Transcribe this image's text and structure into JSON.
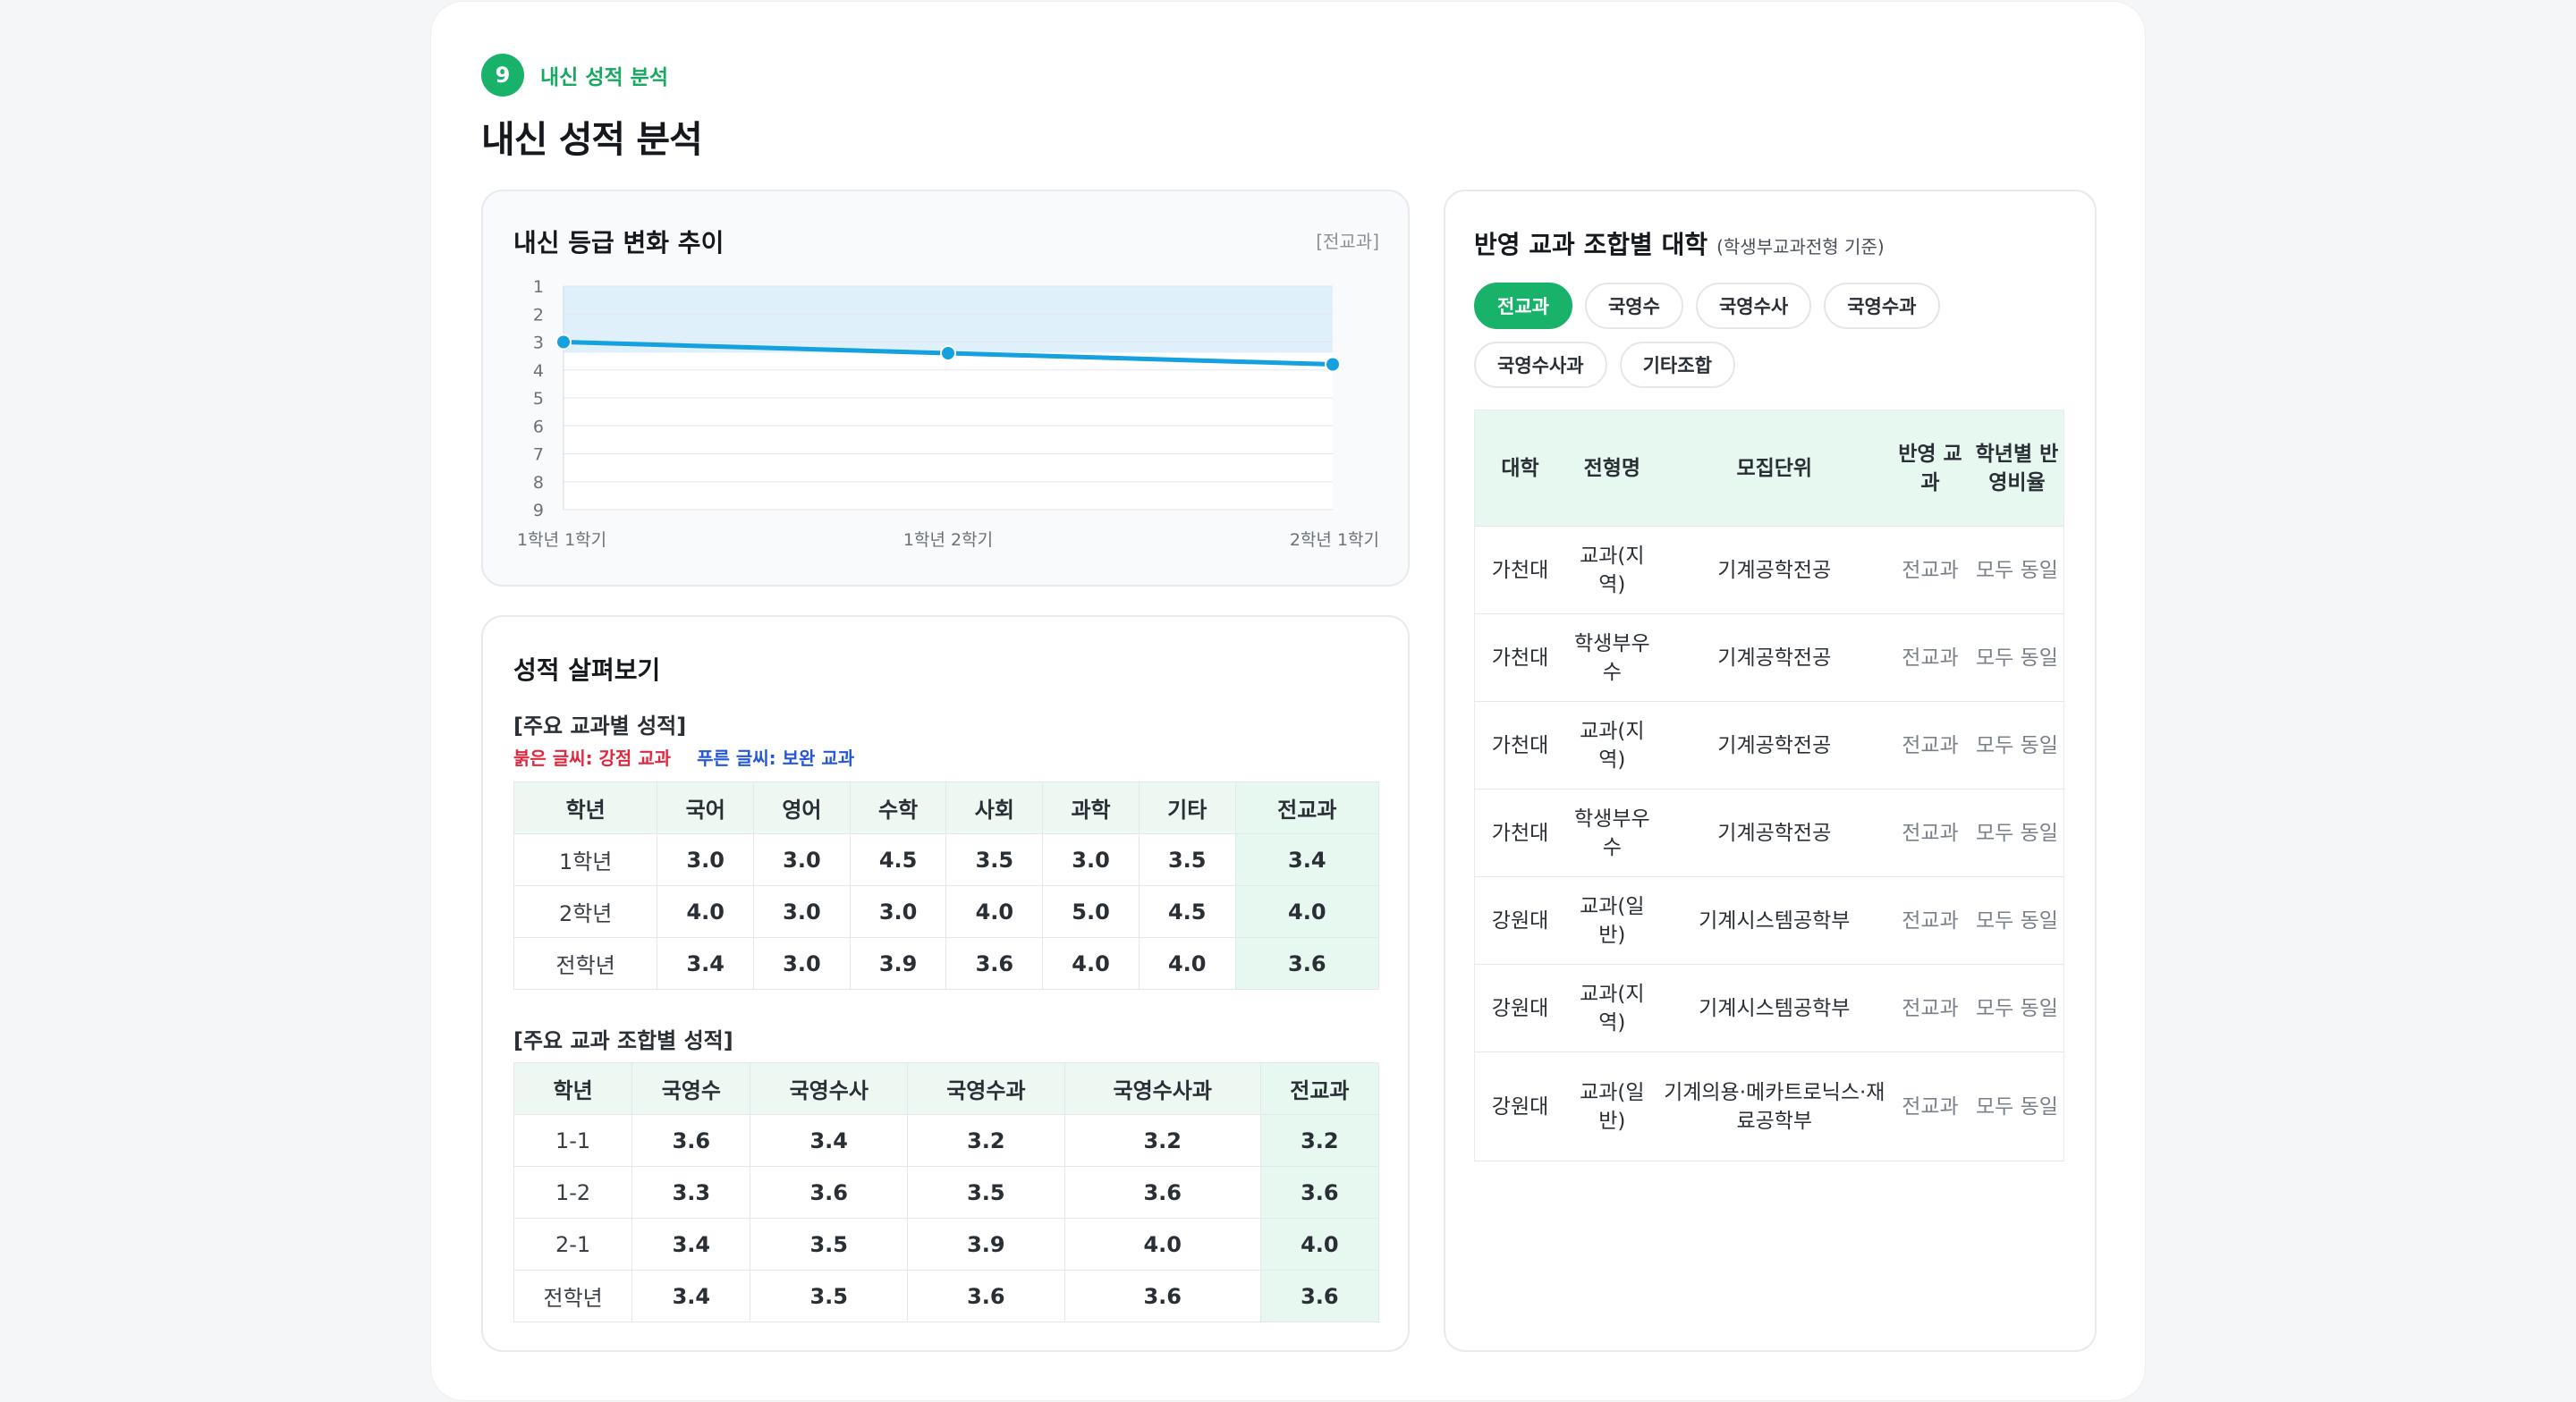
{
  "header": {
    "step_number": "9",
    "step_label": "내신 성적 분석",
    "title": "내신 성적 분석"
  },
  "trend": {
    "title": "내신 등급 변화 추이",
    "tag": "[전교과]"
  },
  "chart_data": {
    "type": "line",
    "x": [
      "1학년 1학기",
      "1학년 2학기",
      "2학년 1학기"
    ],
    "series": [
      {
        "values": [
          3.0,
          3.4,
          3.8
        ]
      }
    ],
    "y_ticks": [
      "1",
      "2",
      "3",
      "4",
      "5",
      "6",
      "7",
      "8",
      "9"
    ],
    "ylim": [
      1,
      9
    ],
    "y_inverted": true,
    "grid": true,
    "line_color": "#15a0e0",
    "fill_color": "#dff0fb"
  },
  "detail": {
    "title": "성적 살펴보기",
    "subject_title": "[주요 교과별 성적]",
    "legend_red": "붉은 글씨: 강점 교과",
    "legend_blue": "푸른 글씨: 보완 교과",
    "subject_table": {
      "headers": [
        "학년",
        "국어",
        "영어",
        "수학",
        "사회",
        "과학",
        "기타",
        "전교과"
      ],
      "rows": [
        [
          "1학년",
          "3.0",
          "3.0",
          "4.5",
          "3.5",
          "3.0",
          "3.5",
          "3.4"
        ],
        [
          "2학년",
          "4.0",
          "3.0",
          "3.0",
          "4.0",
          "5.0",
          "4.5",
          "4.0"
        ],
        [
          "전학년",
          "3.4",
          "3.0",
          "3.9",
          "3.6",
          "4.0",
          "4.0",
          "3.6"
        ]
      ]
    },
    "combo_title": "[주요 교과 조합별 성적]",
    "combo_table": {
      "headers": [
        "학년",
        "국영수",
        "국영수사",
        "국영수과",
        "국영수사과",
        "전교과"
      ],
      "rows": [
        [
          "1-1",
          "3.6",
          "3.4",
          "3.2",
          "3.2",
          "3.2"
        ],
        [
          "1-2",
          "3.3",
          "3.6",
          "3.5",
          "3.6",
          "3.6"
        ],
        [
          "2-1",
          "3.4",
          "3.5",
          "3.9",
          "4.0",
          "4.0"
        ],
        [
          "전학년",
          "3.4",
          "3.5",
          "3.6",
          "3.6",
          "3.6"
        ]
      ]
    }
  },
  "univ": {
    "title": "반영 교과 조합별 대학",
    "note": "(학생부교과전형 기준)",
    "chips": [
      "전교과",
      "국영수",
      "국영수사",
      "국영수과",
      "국영수사과",
      "기타조합"
    ],
    "active_chip": 0,
    "headers": [
      "대학",
      "전형명",
      "모집단위",
      "반영 교과",
      "학년별 반영비율"
    ],
    "rows": [
      [
        "가천대",
        "교과(지역)",
        "기계공학전공",
        "전교과",
        "모두 동일"
      ],
      [
        "가천대",
        "학생부우수",
        "기계공학전공",
        "전교과",
        "모두 동일"
      ],
      [
        "가천대",
        "교과(지역)",
        "기계공학전공",
        "전교과",
        "모두 동일"
      ],
      [
        "가천대",
        "학생부우수",
        "기계공학전공",
        "전교과",
        "모두 동일"
      ],
      [
        "강원대",
        "교과(일반)",
        "기계시스템공학부",
        "전교과",
        "모두 동일"
      ],
      [
        "강원대",
        "교과(지역)",
        "기계시스템공학부",
        "전교과",
        "모두 동일"
      ],
      [
        "강원대",
        "교과(일반)",
        "기계의용·메카트로닉스·재료공학부",
        "전교과",
        "모두 동일"
      ]
    ]
  }
}
